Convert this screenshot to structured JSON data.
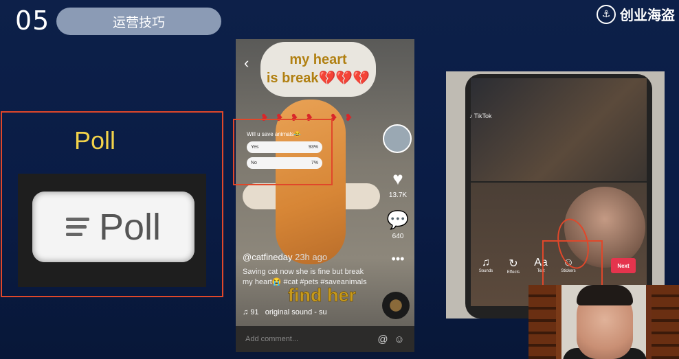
{
  "header": {
    "slide_number": "05",
    "title": "运营技巧",
    "brand": "创业海盗"
  },
  "left_panel": {
    "heading": "Poll",
    "button_label": "Poll"
  },
  "center_phone": {
    "sticker_text_1": "my heart",
    "sticker_text_2": "is break💔💔💔",
    "poll_question": "Will u save animals😂",
    "poll_options": [
      {
        "label": "Yes",
        "pct": "93%"
      },
      {
        "label": "No",
        "pct": "7%"
      }
    ],
    "like_count": "13.7K",
    "comment_count": "640",
    "username": "@catfineday",
    "time_ago": "23h ago",
    "caption": "Saving cat now she is fine but break my heart😭 #cat #pets #saveanimals",
    "overlay_text": "find her",
    "music_count": "91",
    "music_label": "original sound - su",
    "comment_placeholder": "Add comment..."
  },
  "right_photo": {
    "app_mark": "TikTok",
    "toolbar": [
      {
        "label": "Sounds",
        "glyph": "♫"
      },
      {
        "label": "Effects",
        "glyph": "↻"
      },
      {
        "label": "Text",
        "glyph": "Aa"
      },
      {
        "label": "Stickers",
        "glyph": "☺"
      }
    ],
    "next_label": "Next"
  },
  "colors": {
    "background": "#0d2049",
    "highlight": "#e0472a",
    "poll_heading": "#f2d24a",
    "title_pill": "#8b9bb5"
  }
}
